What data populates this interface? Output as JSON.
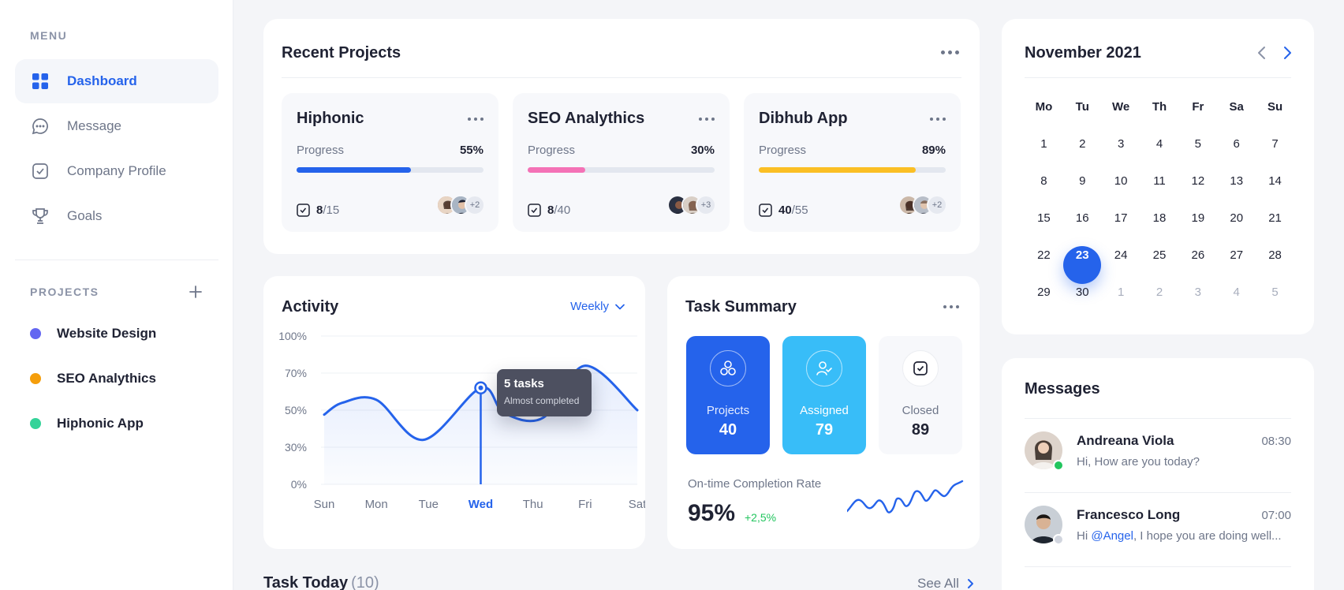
{
  "sidebar": {
    "menu_title": "MENU",
    "items": [
      {
        "label": "Dashboard",
        "icon": "grid-icon",
        "active": true
      },
      {
        "label": "Message",
        "icon": "chat-icon",
        "active": false
      },
      {
        "label": "Company Profile",
        "icon": "check-square-icon",
        "active": false
      },
      {
        "label": "Goals",
        "icon": "trophy-icon",
        "active": false
      }
    ],
    "projects_title": "PROJECTS",
    "projects": [
      {
        "label": "Website Design",
        "color": "#6366f1"
      },
      {
        "label": "SEO Analythics",
        "color": "#f59e0b"
      },
      {
        "label": "Hiphonic App",
        "color": "#34d399"
      }
    ]
  },
  "recent_projects": {
    "title": "Recent Projects",
    "cards": [
      {
        "name": "Hiphonic",
        "progress_label": "Progress",
        "progress": "55%",
        "progress_value": 0.61,
        "color": "#2563eb",
        "done": "8",
        "total": "/15",
        "extra": "+2"
      },
      {
        "name": "SEO Analythics",
        "progress_label": "Progress",
        "progress": "30%",
        "progress_value": 0.31,
        "color": "#f472b6",
        "done": "8",
        "total": "/40",
        "extra": "+3"
      },
      {
        "name": "Dibhub App",
        "progress_label": "Progress",
        "progress": "89%",
        "progress_value": 0.84,
        "color": "#fbbf24",
        "done": "40",
        "total": "/55",
        "extra": "+2"
      }
    ]
  },
  "activity": {
    "title": "Activity",
    "filter": "Weekly",
    "tooltip": {
      "title": "5 tasks",
      "subtitle": "Almost completed"
    }
  },
  "chart_data": {
    "type": "line",
    "categories": [
      "Sun",
      "Mon",
      "Tue",
      "Wed",
      "Thu",
      "Fri",
      "Sat"
    ],
    "y_ticks": [
      "100%",
      "70%",
      "50%",
      "30%",
      "0%"
    ],
    "highlight": "Wed",
    "series": [
      {
        "values": [
          [
            0,
            47
          ],
          [
            0.35,
            55
          ],
          [
            1,
            57
          ],
          [
            1.9,
            30
          ],
          [
            3,
            65
          ],
          [
            3.45,
            48
          ],
          [
            4.2,
            45
          ],
          [
            5,
            80
          ],
          [
            6,
            50
          ]
        ]
      }
    ],
    "ylim": [
      0,
      100
    ],
    "grid": true,
    "color": "#2563eb"
  },
  "task_summary": {
    "title": "Task Summary",
    "stats": [
      {
        "label": "Projects",
        "value": "40",
        "icon": "projects-icon",
        "bg": "#2563eb"
      },
      {
        "label": "Assigned",
        "value": "79",
        "icon": "user-check-icon",
        "bg": "#38bdf8"
      },
      {
        "label": "Closed",
        "value": "89",
        "icon": "check-square-icon",
        "bg": "#f7f8fb"
      }
    ],
    "completion_label": "On-time Completion Rate",
    "completion_value": "95%",
    "completion_change": "+2,5%"
  },
  "calendar": {
    "title": "November 2021",
    "weekdays": [
      "Mo",
      "Tu",
      "We",
      "Th",
      "Fr",
      "Sa",
      "Su"
    ],
    "days": [
      {
        "d": "1"
      },
      {
        "d": "2"
      },
      {
        "d": "3"
      },
      {
        "d": "4"
      },
      {
        "d": "5"
      },
      {
        "d": "6"
      },
      {
        "d": "7"
      },
      {
        "d": "8"
      },
      {
        "d": "9"
      },
      {
        "d": "10"
      },
      {
        "d": "11"
      },
      {
        "d": "12"
      },
      {
        "d": "13"
      },
      {
        "d": "14"
      },
      {
        "d": "15"
      },
      {
        "d": "16"
      },
      {
        "d": "17"
      },
      {
        "d": "18"
      },
      {
        "d": "19"
      },
      {
        "d": "20"
      },
      {
        "d": "21"
      },
      {
        "d": "22"
      },
      {
        "d": "23",
        "selected": true
      },
      {
        "d": "24"
      },
      {
        "d": "25"
      },
      {
        "d": "26"
      },
      {
        "d": "27"
      },
      {
        "d": "28"
      },
      {
        "d": "29"
      },
      {
        "d": "30"
      },
      {
        "d": "1",
        "muted": true
      },
      {
        "d": "2",
        "muted": true
      },
      {
        "d": "3",
        "muted": true
      },
      {
        "d": "4",
        "muted": true
      },
      {
        "d": "5",
        "muted": true
      }
    ]
  },
  "messages": {
    "title": "Messages",
    "items": [
      {
        "name": "Andreana Viola",
        "time": "08:30",
        "text": "Hi, How are you today?",
        "online": true
      },
      {
        "name": "Francesco Long",
        "time": "07:00",
        "prefix": "Hi ",
        "mention": "@Angel",
        "suffix": ", I hope you are doing well...",
        "online": false
      }
    ]
  },
  "task_today": {
    "title": "Task Today",
    "count": "(10)",
    "see_all": "See All"
  }
}
